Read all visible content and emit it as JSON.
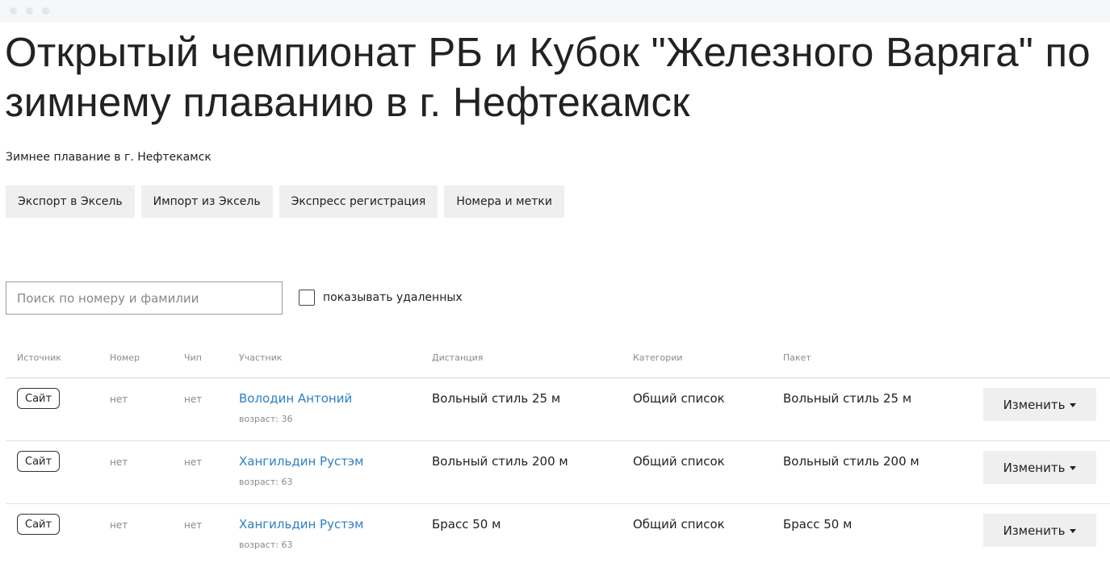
{
  "page": {
    "title": "Открытый чемпионат РБ и Кубок \"Железного Варяга\" по зимнему плаванию в г. Нефтекамск",
    "subtitle": "Зимнее плавание в г. Нефтекамск"
  },
  "toolbar": {
    "buttons": [
      {
        "label": "Экспорт в Эксель"
      },
      {
        "label": "Импорт из Эксель"
      },
      {
        "label": "Экспресс регистрация"
      },
      {
        "label": "Номера и метки"
      }
    ]
  },
  "filters": {
    "search_placeholder": "Поиск по номеру и фамилии",
    "search_value": "",
    "show_deleted_label": "показывать удаленных",
    "show_deleted_checked": false
  },
  "table": {
    "headers": {
      "source": "Источник",
      "number": "Номер",
      "chip": "Чип",
      "participant": "Участник",
      "distance": "Дистанция",
      "categories": "Категории",
      "package": "Пакет"
    },
    "edit_label": "Изменить",
    "rows": [
      {
        "source": "Сайт",
        "number": "нет",
        "chip": "нет",
        "name": "Володин Антоний",
        "age": "возраст: 36",
        "distance": "Вольный стиль 25 м",
        "category": "Общий список",
        "package": "Вольный стиль 25 м"
      },
      {
        "source": "Сайт",
        "number": "нет",
        "chip": "нет",
        "name": "Хангильдин Рустэм",
        "age": "возраст: 63",
        "distance": "Вольный стиль 200 м",
        "category": "Общий список",
        "package": "Вольный стиль 200 м"
      },
      {
        "source": "Сайт",
        "number": "нет",
        "chip": "нет",
        "name": "Хангильдин Рустэм",
        "age": "возраст: 63",
        "distance": "Брасс 50 м",
        "category": "Общий список",
        "package": "Брасс 50 м"
      }
    ]
  },
  "colors": {
    "link": "#2f7fc4",
    "button_bg": "#efefef",
    "muted_text": "#8a8a8a"
  }
}
